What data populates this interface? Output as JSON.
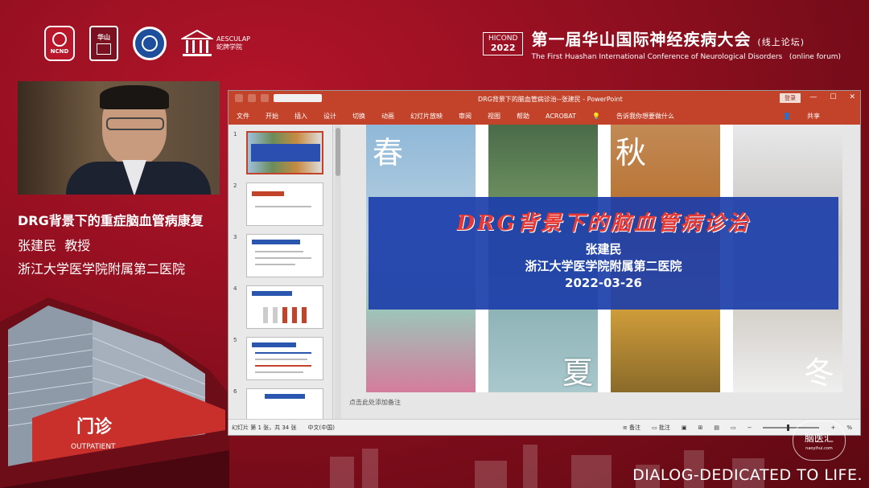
{
  "header": {
    "logos": [
      "NCND",
      "华山医院",
      "学会徽章",
      "AESCULAP 蛇牌学院"
    ],
    "aesculap_label": "AESCULAP",
    "aesculap_cn": "蛇牌学院",
    "hicond": "HICOND",
    "hicond_year": "2022",
    "conference_title": "第一届华山国际神经疾病大会",
    "conference_tag": "(线上论坛)",
    "conference_en": "The First Huashan International Conference of Neurological Disorders",
    "conference_en_tag": "(online forum)"
  },
  "speaker": {
    "talk_title": "DRG背景下的重症脑血管病康复",
    "name": "张建民",
    "role": "教授",
    "institution": "浙江大学医学院附属第二医院"
  },
  "ppt": {
    "window_title": "DRG背景下的脑血管病诊治--张建民  -  PowerPoint",
    "login": "登录",
    "ribbon_tabs": [
      "文件",
      "开始",
      "插入",
      "设计",
      "切换",
      "动画",
      "幻灯片放映",
      "审阅",
      "视图",
      "帮助",
      "ACROBAT"
    ],
    "tell_me": "告诉我你想要做什么",
    "share": "共享",
    "thumb_numbers": [
      "1",
      "2",
      "3",
      "4",
      "5",
      "6"
    ],
    "selected_slide": 1,
    "slide": {
      "seasons": [
        "春",
        "秋",
        "夏",
        "冬"
      ],
      "title": "DRG背景下的脑血管病诊治",
      "author": "张建民",
      "institution": "浙江大学医学院附属第二医院",
      "date": "2022-03-26"
    },
    "notes_placeholder": "点击此处添加备注",
    "status": {
      "slide_count": "幻灯片 第 1 张，共 34 张",
      "language": "中文(中国)",
      "notes": "备注",
      "comments": "批注",
      "zoom": "%"
    },
    "accent": "#c2432a"
  },
  "footer": {
    "brand": "脑医汇",
    "brand_small": "naoyihui.com",
    "tagline": "DIALOG-DEDICATED TO LIFE."
  }
}
